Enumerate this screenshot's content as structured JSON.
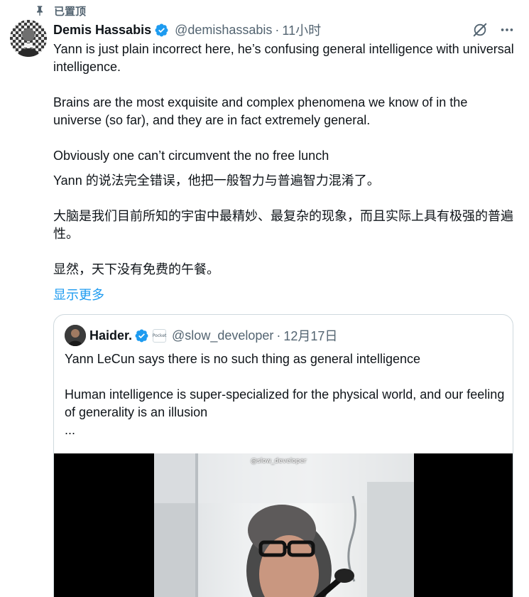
{
  "pinned": {
    "label": "已置顶",
    "icon": "pin-icon"
  },
  "author": {
    "name": "Demis Hassabis",
    "handle": "@demishassabis",
    "separator": "·",
    "time": "11小时",
    "verified_color": "#1d9bf0"
  },
  "actions": {
    "grok_icon": "grok-icon",
    "more_icon": "more-icon"
  },
  "tweet": {
    "en_p1": "Yann is just plain incorrect here, he’s confusing general intelligence with universal intelligence.",
    "en_p2": "Brains are the most exquisite and complex phenomena we know of in the universe (so far), and they are in fact extremely general.",
    "en_p3": "Obviously one can’t circumvent the no free lunch",
    "zh_p1": "Yann 的说法完全错误，他把一般智力与普遍智力混淆了。",
    "zh_p2": "大脑是我们目前所知的宇宙中最精妙、最复杂的现象，而且实际上具有极强的普遍性。",
    "zh_p3": "显然，天下没有免费的午餐。",
    "show_more": "显示更多"
  },
  "quote": {
    "name": "Haider.",
    "badge": "Pocket",
    "handle": "@slow_developer",
    "separator": "·",
    "time": "12月17日",
    "p1": "Yann LeCun says there is no such thing as general intelligence",
    "p2": "Human intelligence is super-specialized for the physical world, and our feeling of generality is an illusion",
    "ellipsis": "...",
    "video_watermark": "@slow_developer"
  },
  "colors": {
    "accent": "#1d9bf0",
    "secondary_text": "#536471",
    "border": "#cfd9de"
  }
}
